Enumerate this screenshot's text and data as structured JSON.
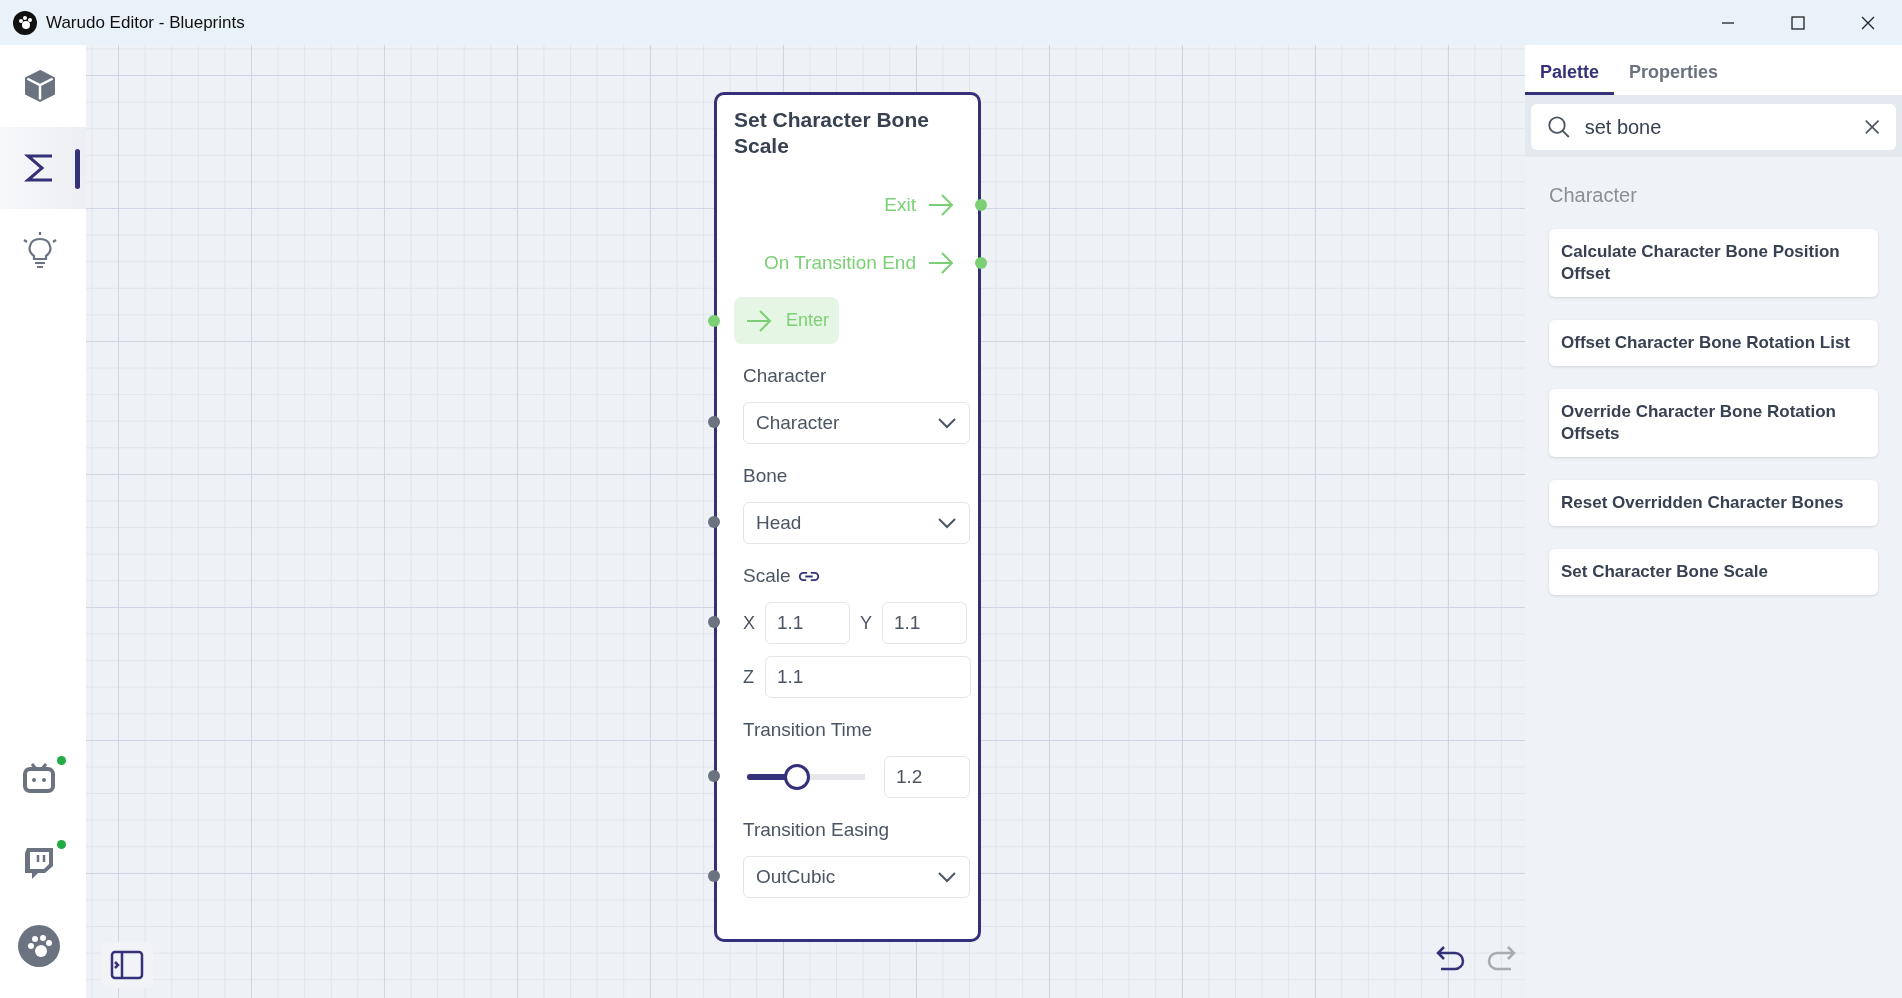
{
  "window": {
    "title": "Warudo Editor - Blueprints"
  },
  "nav": [
    {
      "kind": "cube",
      "selected": false
    },
    {
      "kind": "sigma",
      "selected": true
    },
    {
      "kind": "bulb",
      "selected": false
    }
  ],
  "services": [
    {
      "kind": "tv",
      "connected": true
    },
    {
      "kind": "chat",
      "connected": true
    },
    {
      "kind": "paw"
    }
  ],
  "node": {
    "title": "Set Character Bone Scale",
    "outputs": [
      {
        "label": "Exit"
      },
      {
        "label": "On Transition End"
      }
    ],
    "enter": {
      "label": "Enter"
    },
    "inputs": [
      {
        "kind": "dropdown",
        "label": "Character",
        "value": "Character"
      },
      {
        "kind": "dropdown",
        "label": "Bone",
        "value": "Head"
      },
      {
        "kind": "vector",
        "label": "Scale",
        "linked": true,
        "fields": [
          {
            "axis": "X",
            "value": "1.1"
          },
          {
            "axis": "Y",
            "value": "1.1"
          },
          {
            "axis": "Z",
            "value": "1.1"
          }
        ]
      },
      {
        "kind": "slider",
        "label": "Transition Time",
        "level": 0.4,
        "value": "1.2"
      },
      {
        "kind": "dropdown",
        "label": "Transition Easing",
        "value": "OutCubic"
      }
    ]
  },
  "history": [
    {
      "kind": "undo",
      "disabled": false
    },
    {
      "kind": "redo",
      "disabled": true
    }
  ],
  "panel": {
    "tabs": [
      {
        "label": "Palette",
        "selected": true
      },
      {
        "label": "Properties",
        "selected": false
      }
    ],
    "search": {
      "value": "set bone"
    },
    "group": "Character",
    "items": [
      {
        "label": "Calculate Character Bone Position Offset"
      },
      {
        "label": "Offset Character Bone Rotation List"
      },
      {
        "label": "Override Character Bone Rotation Offsets"
      },
      {
        "label": "Reset Overridden Character Bones"
      },
      {
        "label": "Set Character Bone Scale"
      }
    ]
  }
}
